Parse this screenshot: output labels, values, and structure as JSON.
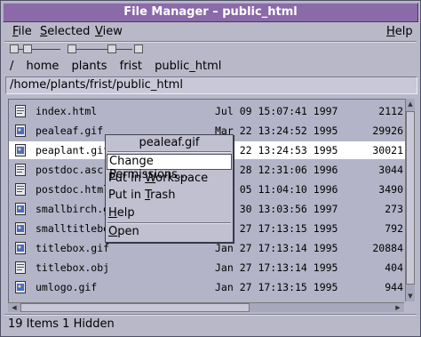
{
  "window": {
    "title": "File Manager – public_html"
  },
  "menubar": {
    "file": {
      "mnemonic": "F",
      "rest": "ile"
    },
    "selected": {
      "mnemonic": "S",
      "rest": "elected"
    },
    "view": {
      "mnemonic": "V",
      "rest": "iew"
    },
    "help": {
      "mnemonic": "H",
      "rest": "elp"
    }
  },
  "breadcrumbs": [
    "/",
    "home",
    "plants",
    "frist",
    "public_html"
  ],
  "path_field": {
    "value": "/home/plants/frist/public_html"
  },
  "files": [
    {
      "name": "index.html",
      "date": "Jul 09 15:07:41 1997",
      "size": "2112",
      "icon": "html-doc-icon"
    },
    {
      "name": "pealeaf.gif",
      "date": "Mar 22 13:24:52 1995",
      "size": "29926",
      "icon": "gif-image-icon"
    },
    {
      "name": "peaplant.gif",
      "date": "Mar 22 13:24:53 1995",
      "size": "30021",
      "icon": "gif-image-icon",
      "selected": true
    },
    {
      "name": "postdoc.asc",
      "date": "Mar 28 12:31:06 1996",
      "size": "3044",
      "icon": "text-doc-icon"
    },
    {
      "name": "postdoc.html",
      "date": "Mar 05 11:04:10 1996",
      "size": "3490",
      "icon": "html-doc-icon"
    },
    {
      "name": "smallbirch.gif",
      "date": "Jan 30 13:03:56 1997",
      "size": "273",
      "icon": "gif-image-icon"
    },
    {
      "name": "smalltitlebox.gif",
      "date": "Jan 27 17:13:15 1995",
      "size": "792",
      "icon": "gif-image-icon"
    },
    {
      "name": "titlebox.gif",
      "date": "Jan 27 17:13:14 1995",
      "size": "20884",
      "icon": "gif-image-icon"
    },
    {
      "name": "titlebox.obj",
      "date": "Jan 27 17:13:14 1995",
      "size": "404",
      "icon": "object-file-icon"
    },
    {
      "name": "umlogo.gif",
      "date": "Jan 27 17:13:15 1995",
      "size": "944",
      "icon": "gif-image-icon"
    }
  ],
  "status": {
    "text": "19 Items 1 Hidden"
  },
  "context_menu": {
    "header": "pealeaf.gif",
    "change_permissions": {
      "before": "Change ",
      "mnemonic": "P",
      "after": "ermissions..."
    },
    "put_in_workspace": {
      "before": "Put in ",
      "mnemonic": "W",
      "after": "orkspace"
    },
    "put_in_trash": {
      "before": "Put in ",
      "mnemonic": "T",
      "after": "rash"
    },
    "help": {
      "mnemonic": "H",
      "after": "elp"
    },
    "open": {
      "mnemonic": "O",
      "after": "pen"
    }
  },
  "colors": {
    "window_bg": "#b8b8c8",
    "titlebar": "#8a6aa8",
    "selection": "#ffffff",
    "list_bg": "#b4b4c8"
  }
}
